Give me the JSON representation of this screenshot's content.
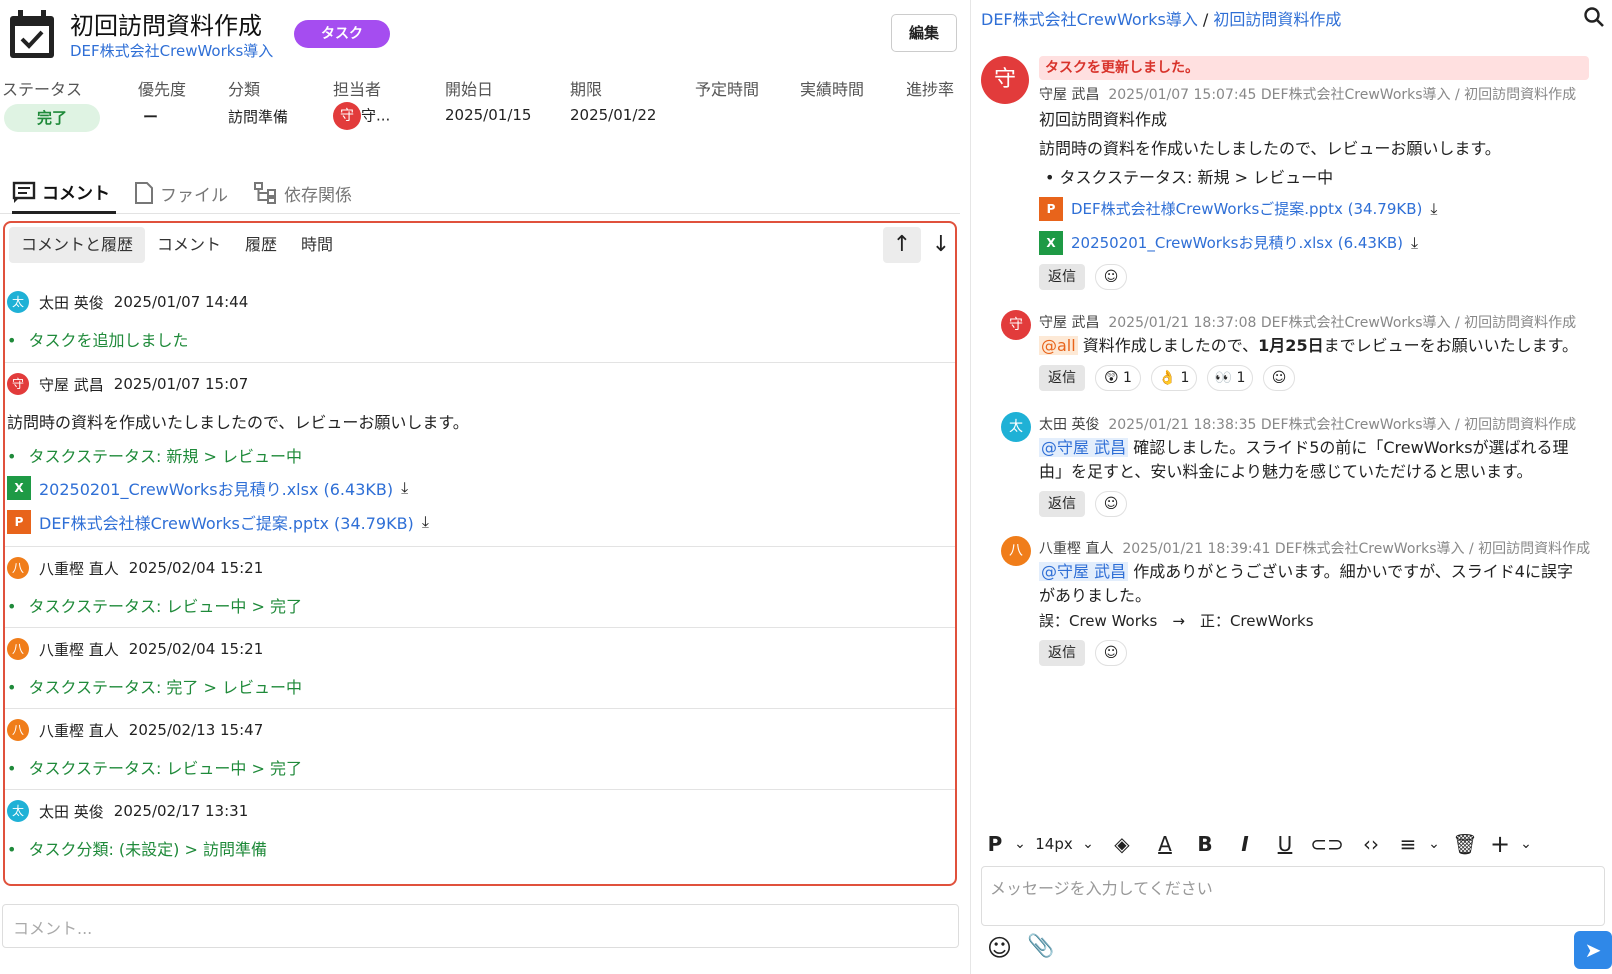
{
  "task": {
    "title": "初回訪問資料作成",
    "badge": "タスク",
    "project": "DEF株式会社CrewWorks導入",
    "edit_label": "編集"
  },
  "props": {
    "headers": [
      "ステータス",
      "優先度",
      "分類",
      "担当者",
      "開始日",
      "期限",
      "予定時間",
      "実績時間",
      "進捗率"
    ],
    "status": "完了",
    "priority": "ー",
    "category": "訪問準備",
    "assignee_avatar": "守",
    "assignee": "守...",
    "start": "2025/01/15",
    "due": "2025/01/22"
  },
  "tabs": {
    "comment": "コメント",
    "file": "ファイル",
    "deps": "依存関係"
  },
  "subtabs": [
    "コメントと履歴",
    "コメント",
    "履歴",
    "時間"
  ],
  "history": [
    {
      "avatar": "太",
      "name": "太田 英俊",
      "time": "2025/01/07 14:44",
      "lines": [
        "タスクを追加しました"
      ]
    },
    {
      "avatar": "守",
      "name": "守屋 武昌",
      "time": "2025/01/07 15:07",
      "comment": "訪問時の資料を作成いたしましたので、レビューお願いします。",
      "lines": [
        "タスクステータス: 新規 > レビュー中"
      ],
      "files": [
        "20250201_CrewWorksお見積り.xlsx (6.43KB)",
        "DEF株式会社様CrewWorksご提案.pptx (34.79KB)"
      ]
    },
    {
      "avatar": "八",
      "name": "八重樫 直人",
      "time": "2025/02/04 15:21",
      "lines": [
        "タスクステータス: レビュー中 > 完了"
      ]
    },
    {
      "avatar": "八",
      "name": "八重樫 直人",
      "time": "2025/02/04 15:21",
      "lines": [
        "タスクステータス: 完了 > レビュー中"
      ]
    },
    {
      "avatar": "八",
      "name": "八重樫 直人",
      "time": "2025/02/13 15:47",
      "lines": [
        "タスクステータス: レビュー中 > 完了"
      ]
    },
    {
      "avatar": "太",
      "name": "太田 英俊",
      "time": "2025/02/17 13:31",
      "lines": [
        "タスク分類: (未設定) > 訪問準備"
      ]
    }
  ],
  "comment_placeholder": "コメント...",
  "right": {
    "breadcrumb_project": "DEF株式会社CrewWorks導入",
    "breadcrumb_sep": " / ",
    "breadcrumb_task": "初回訪問資料作成",
    "thread": {
      "avatar": "守",
      "update": "タスクを更新しました。",
      "author": "守屋 武昌",
      "meta": "2025/01/07 15:07:45  DEF株式会社CrewWorks導入 / 初回訪問資料作成",
      "link": "初回訪問資料作成",
      "body": "訪問時の資料を作成いたしましたので、レビューお願いします。",
      "status_line": "タスクステータス: 新規 > レビュー中",
      "file1": "DEF株式会社様CrewWorksご提案.pptx (34.79KB)",
      "file2": "20250201_CrewWorksお見積り.xlsx (6.43KB)",
      "reply": "返信"
    },
    "replies": [
      {
        "avatar": "守",
        "author": "守屋 武昌",
        "meta": "2025/01/21 18:37:08  DEF株式会社CrewWorks導入 / 初回訪問資料作成",
        "mention": "@all",
        "pre": "資料作成しましたので、",
        "bold": "1月25日",
        "post": "までレビューをお願いいたします。",
        "reactions": [
          "😲 1",
          "👌 1",
          "👀 1"
        ]
      },
      {
        "avatar": "太",
        "author": "太田 英俊",
        "meta": "2025/01/21 18:38:35  DEF株式会社CrewWorks導入 / 初回訪問資料作成",
        "mention": "@守屋 武昌",
        "line1": "確認しました。スライド5の前に「CrewWorksが選ばれる理",
        "line2": "由」を足すと、安い料金により魅力を感じていただけると思います。"
      },
      {
        "avatar": "八",
        "author": "八重樫 直人",
        "meta": "2025/01/21 18:39:41  DEF株式会社CrewWorks導入 / 初回訪問資料作成",
        "mention": "@守屋 武昌",
        "line1": "作成ありがとうございます。細かいですが、スライド4に誤字",
        "line2": "がありました。",
        "line3": "誤：Crew Works　→　正：CrewWorks"
      }
    ],
    "reply_label": "返信",
    "toolbar": {
      "paragraph": "P",
      "size": "14px"
    },
    "msg_placeholder": "メッセージを入力してください"
  }
}
